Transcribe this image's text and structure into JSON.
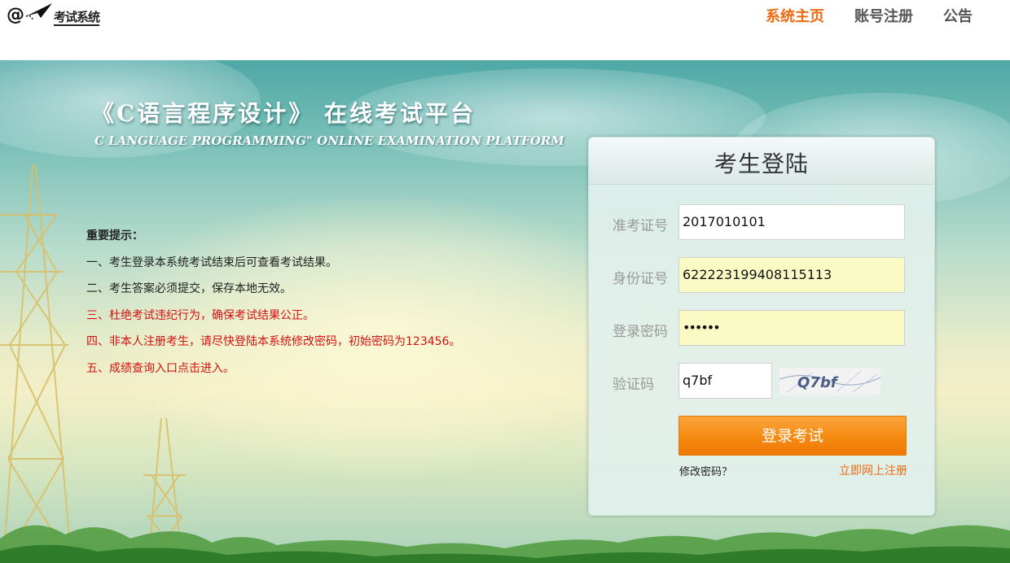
{
  "header": {
    "logo_text": "考试系统",
    "nav": [
      {
        "label": "系统主页",
        "active": true
      },
      {
        "label": "账号注册",
        "active": false
      },
      {
        "label": "公告",
        "active": false
      }
    ]
  },
  "banner": {
    "title_cn": "《C语言程序设计》 在线考试平台",
    "title_en": "C LANGUAGE PROGRAMMING\" ONLINE EXAMINATION PLATFORM"
  },
  "notice": {
    "heading": "重要提示：",
    "items": [
      {
        "text": "一、考生登录本系统考试结束后可查看考试结果。",
        "color": "#222222"
      },
      {
        "text": "二、考生答案必须提交，保存本地无效。",
        "color": "#222222"
      },
      {
        "text": "三、杜绝考试违纪行为，确保考试结果公正。",
        "color": "#d41010"
      },
      {
        "text": "四、非本人注册考生，请尽快登陆本系统修改密码，初始密码为123456。",
        "color": "#d41010"
      },
      {
        "text": "五、成绩查询入口点击进入。",
        "color": "#d41010"
      }
    ]
  },
  "login": {
    "title": "考生登陆",
    "fields": {
      "exam_id": {
        "label": "准考证号",
        "value": "2017010101"
      },
      "id_card": {
        "label": "身份证号",
        "value": "622223199408115113"
      },
      "password": {
        "label": "登录密码",
        "value": "••••••"
      },
      "captcha": {
        "label": "验证码",
        "value": "q7bf",
        "image_text": "Q7bf"
      }
    },
    "submit_label": "登录考试",
    "change_password_label": "修改密码？",
    "register_label": "立即网上注册"
  },
  "colors": {
    "accent": "#ee6a12",
    "button": "#f58a10",
    "notice_red": "#d41010"
  }
}
